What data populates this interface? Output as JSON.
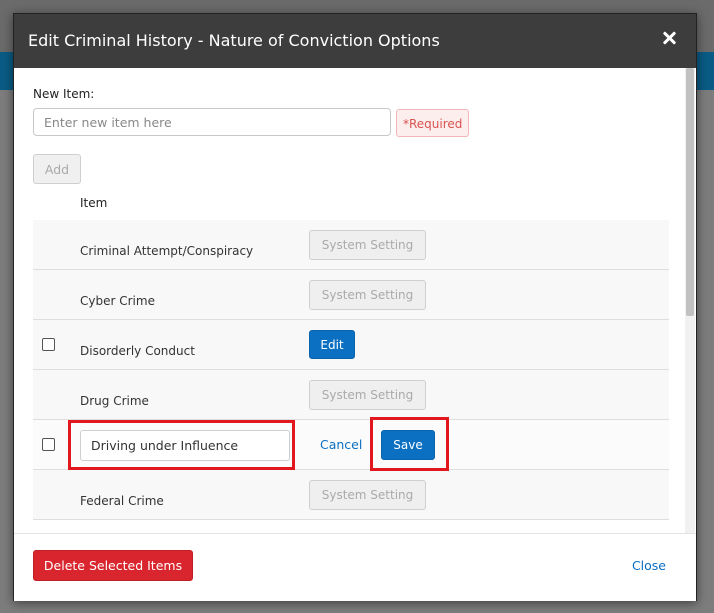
{
  "modal": {
    "title": "Edit Criminal History - Nature of Conviction Options",
    "close_icon": "close-icon"
  },
  "form": {
    "new_item_label": "New Item:",
    "new_item_placeholder": "Enter new item here",
    "required_text": "*Required",
    "add_label": "Add"
  },
  "table": {
    "header_item": "Item",
    "rows": [
      {
        "name": "Criminal Attempt/Conspiracy",
        "action": "System Setting"
      },
      {
        "name": "Cyber Crime",
        "action": "System Setting"
      },
      {
        "name": "Disorderly Conduct",
        "action": "Edit"
      },
      {
        "name": "Drug Crime",
        "action": "System Setting"
      },
      {
        "name": "Driving under Influence",
        "cancel": "Cancel",
        "save": "Save"
      },
      {
        "name": "Federal Crime",
        "action": "System Setting"
      }
    ]
  },
  "footer": {
    "delete_label": "Delete Selected Items",
    "close_label": "Close"
  },
  "colors": {
    "header_bg": "#3d3d3d",
    "primary": "#0b6fc2",
    "danger": "#d9252e",
    "highlight": "#e2161d"
  }
}
